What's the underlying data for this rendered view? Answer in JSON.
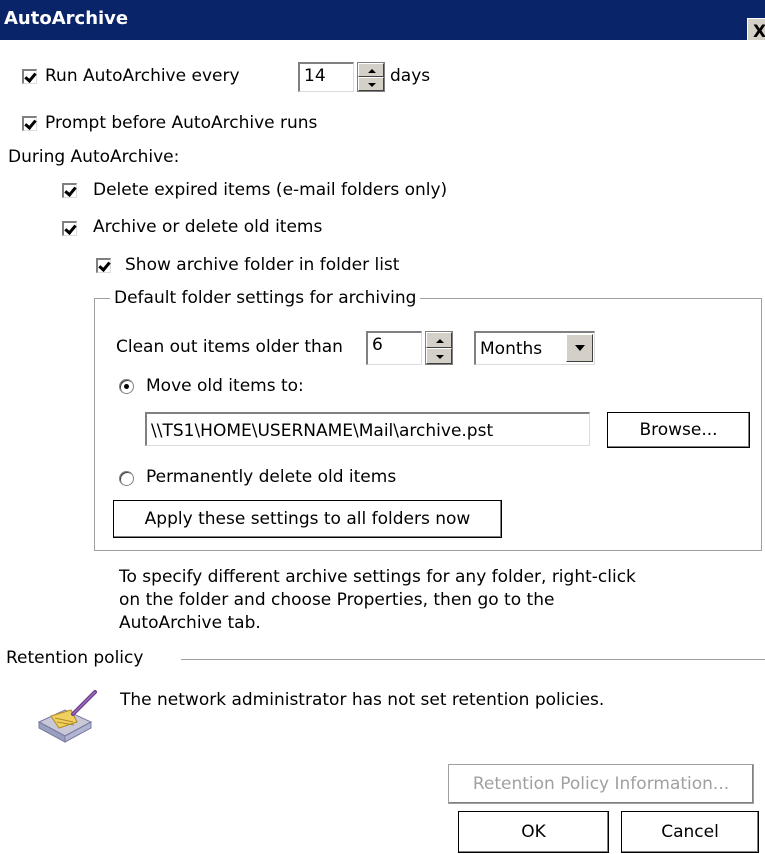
{
  "dialog": {
    "title": "AutoArchive",
    "close_glyph": "X"
  },
  "run_autoarchive": {
    "label": "Run AutoArchive every",
    "checked": true,
    "value": "14",
    "unit": "days"
  },
  "prompt_before": {
    "label": "Prompt before AutoArchive runs",
    "checked": true
  },
  "during": {
    "heading": "During AutoArchive:",
    "delete_expired": {
      "label": "Delete expired items (e-mail folders only)",
      "checked": true
    },
    "archive_old": {
      "label": "Archive or delete old items",
      "checked": true
    },
    "show_folder": {
      "label": "Show archive folder in folder list",
      "checked": true
    }
  },
  "defaults": {
    "legend": "Default folder settings for archiving",
    "clean_label": "Clean out items older than",
    "clean_value": "6",
    "period_selected": "Months",
    "move_label": "Move old items to:",
    "move_selected": true,
    "path_value": "\\\\TS1\\HOME\\USERNAME\\Mail\\archive.pst",
    "browse_label": "Browse...",
    "delete_label": "Permanently delete old items",
    "apply_label": "Apply these settings to all folders now"
  },
  "note": {
    "line1": "To specify different archive settings for any folder, right-click",
    "line2": "on the folder and choose Properties, then go to the",
    "line3": "AutoArchive tab."
  },
  "retention": {
    "heading": "Retention policy",
    "message": "The network administrator has not set retention policies.",
    "info_button": "Retention Policy Information...",
    "icon": "broom-icon"
  },
  "footer": {
    "ok": "OK",
    "cancel": "Cancel"
  }
}
